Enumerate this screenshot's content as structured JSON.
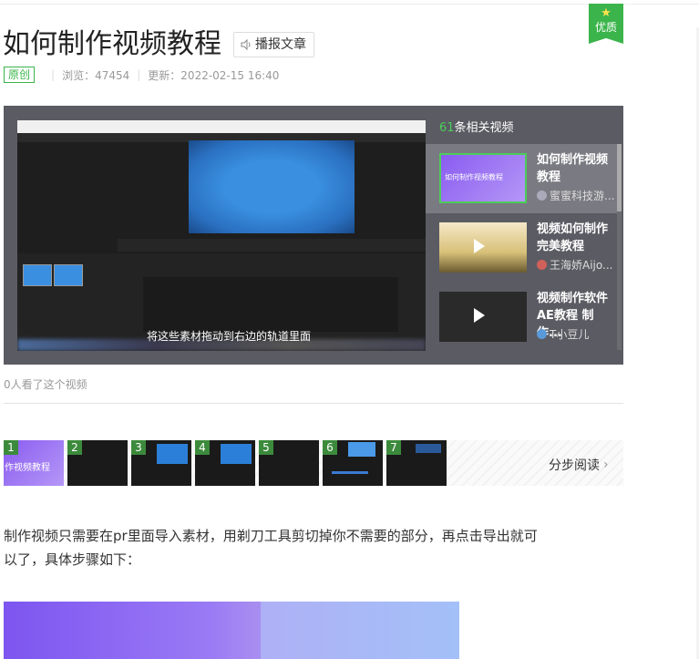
{
  "badge": {
    "label": "优质"
  },
  "article": {
    "title": "如何制作视频教程",
    "read_aloud": "播报文章",
    "tag": "原创",
    "views_label": "浏览：47454",
    "updated_label": "更新：2022-02-15 16:40"
  },
  "video": {
    "subtitle": "将这些素材拖动到右边的轨道里面",
    "related_count": "61",
    "related_suffix": "条相关视频",
    "thumb1_overlay": "如何制作视频教程",
    "step1_overlay": "作视频教程",
    "items": [
      {
        "title": "如何制作视频教程",
        "author": "蜜蜜科技游..."
      },
      {
        "title": "视频如何制作完美教程",
        "author": "王海娇Aijo..."
      },
      {
        "title": "视频制作软件AE教程 制作...",
        "author": "T小豆儿"
      }
    ],
    "watch_count": "0人看了这个视频"
  },
  "steps": {
    "numbers": [
      "1",
      "2",
      "3",
      "4",
      "5",
      "6",
      "7"
    ],
    "read_label": "分步阅读"
  },
  "content": {
    "paragraph": "制作视频只需要在pr里面导入素材，用剃刀工具剪切掉你不需要的部分，再点击导出就可以了，具体步骤如下："
  },
  "colors": {
    "accent_green": "#3bb44b",
    "player_bg": "#5b5b63"
  }
}
